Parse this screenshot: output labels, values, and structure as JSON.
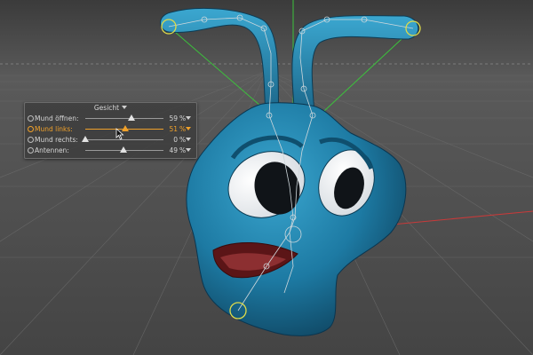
{
  "panel": {
    "title": "Gesicht",
    "sliders": [
      {
        "label": "Mund öffnen:",
        "value": "59",
        "level": 0.59,
        "unit": "%",
        "active": false
      },
      {
        "label": "Mund links:",
        "value": "51",
        "level": 0.51,
        "unit": "%",
        "active": true
      },
      {
        "label": "Mund rechts:",
        "value": "0",
        "level": 0.0,
        "unit": "%",
        "active": false
      },
      {
        "label": "Antennen:",
        "value": "49",
        "level": 0.49,
        "unit": "%",
        "active": false
      }
    ]
  },
  "colors": {
    "accent": "#f0a12a",
    "character": "#1f7fa8",
    "viewport_bg": "#4a4a4a",
    "axis_green": "#3cc23c",
    "axis_red": "#c83a3a"
  },
  "icons": [
    "title-dropdown-icon",
    "radio-icon",
    "slider-thumb-icon",
    "row-dropdown-icon",
    "mouse-cursor-icon"
  ]
}
